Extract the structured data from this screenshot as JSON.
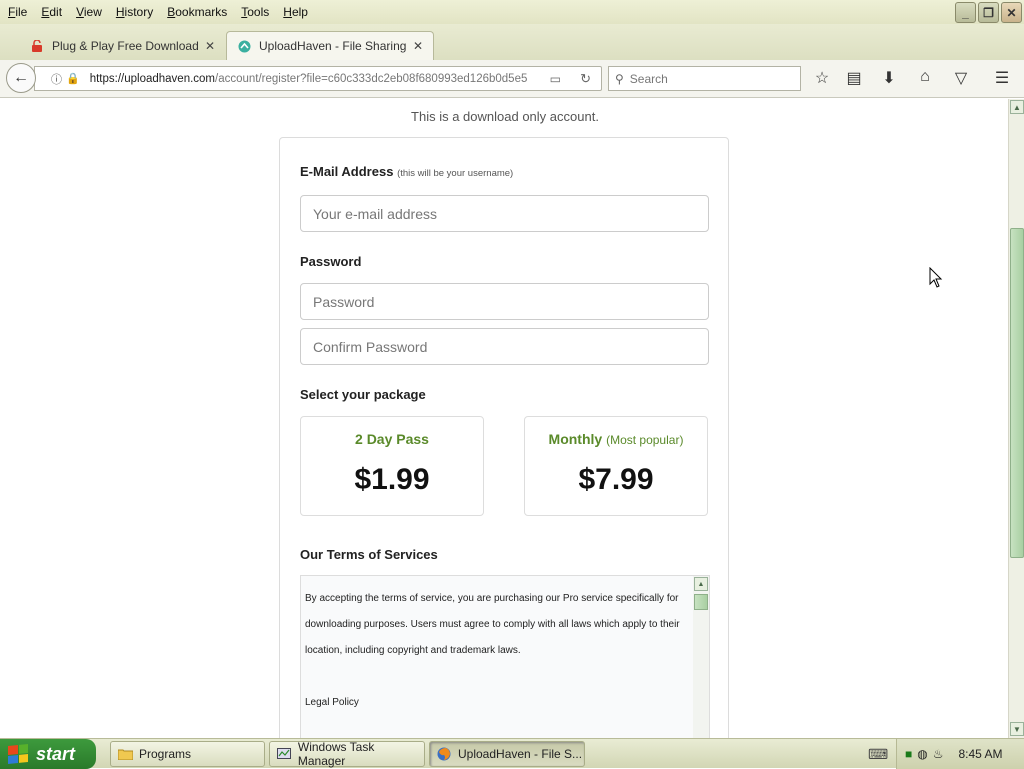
{
  "browser": {
    "menu": [
      "File",
      "Edit",
      "View",
      "History",
      "Bookmarks",
      "Tools",
      "Help"
    ],
    "window_buttons": {
      "minimize": "_",
      "maximize": "❐",
      "close": "✕"
    },
    "tabs": [
      {
        "title": "Plug & Play Free Download » ...",
        "close": "✕"
      },
      {
        "title": "UploadHaven - File Sharing M...",
        "close": "✕"
      }
    ],
    "new_tab": "+",
    "url_prefix": "https://uploadhaven.com",
    "url_path": "/account/register?file=c60c333dc2eb08f680993ed126b0d5e5",
    "search_placeholder": "Search"
  },
  "page": {
    "download_note": "This is a download only account.",
    "email_label": "E-Mail Address",
    "email_hint": "(this will be your username)",
    "email_placeholder": "Your e-mail address",
    "password_label": "Password",
    "password_placeholder": "Password",
    "confirm_placeholder": "Confirm Password",
    "package_label": "Select your package",
    "packages": [
      {
        "name": "2 Day Pass",
        "badge": "",
        "price": "$1.99"
      },
      {
        "name": "Monthly",
        "badge": "(Most popular)",
        "price": "$7.99"
      }
    ],
    "terms_label": "Our Terms of Services",
    "terms_text": "By accepting the terms of service, you are purchasing our Pro service specifically for downloading purposes. Users must agree to comply with all laws which apply to their location, including copyright and trademark laws.",
    "legal_policy": "Legal Policy"
  },
  "taskbar": {
    "start": "start",
    "tasks": [
      {
        "label": "Programs",
        "icon": "folder-icon"
      },
      {
        "label": "Windows Task Manager",
        "icon": "task-manager-icon"
      },
      {
        "label": "UploadHaven - File S...",
        "icon": "firefox-icon"
      }
    ],
    "clock": "8:45 AM"
  }
}
